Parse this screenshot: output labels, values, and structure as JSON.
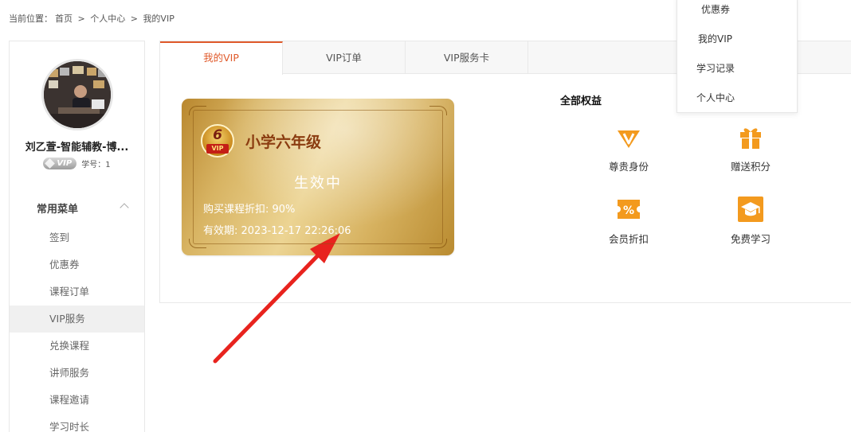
{
  "breadcrumb": {
    "prefix": "当前位置：",
    "items": [
      "首页",
      ">",
      "个人中心",
      ">",
      "我的VIP"
    ]
  },
  "user": {
    "name": "刘乙萱-智能辅教-博...",
    "badge": "VIP",
    "student_id": "学号：1"
  },
  "sidebar": {
    "section_title": "常用菜单",
    "items": [
      {
        "label": "签到"
      },
      {
        "label": "优惠券"
      },
      {
        "label": "课程订单"
      },
      {
        "label": "VIP服务"
      },
      {
        "label": "兑换课程"
      },
      {
        "label": "讲师服务"
      },
      {
        "label": "课程邀请"
      },
      {
        "label": "学习时长"
      }
    ],
    "active_index": 3
  },
  "tabs": [
    {
      "label": "我的VIP"
    },
    {
      "label": "VIP订单"
    },
    {
      "label": "VIP服务卡"
    }
  ],
  "vip_card": {
    "badge_number": "6",
    "badge_text": "VIP",
    "grade": "小学六年级",
    "status": "生效中",
    "discount": "购买课程折扣: 90%",
    "expire": "有效期: 2023-12-17 22:26:06"
  },
  "benefits": {
    "title": "全部权益",
    "items": [
      {
        "label": "尊贵身份",
        "icon": "v-diamond-icon"
      },
      {
        "label": "赠送积分",
        "icon": "gift-icon"
      },
      {
        "label": "会员折扣",
        "icon": "percent-ticket-icon"
      },
      {
        "label": "免费学习",
        "icon": "graduation-cap-icon"
      }
    ]
  },
  "dropdown": {
    "items": [
      {
        "label": "优惠券"
      },
      {
        "label": "我的VIP"
      },
      {
        "label": "学习记录"
      },
      {
        "label": "个人中心"
      }
    ]
  },
  "colors": {
    "accent": "#e05a2b",
    "icon_orange": "#f39a1e",
    "arrow": "#e8231e"
  }
}
